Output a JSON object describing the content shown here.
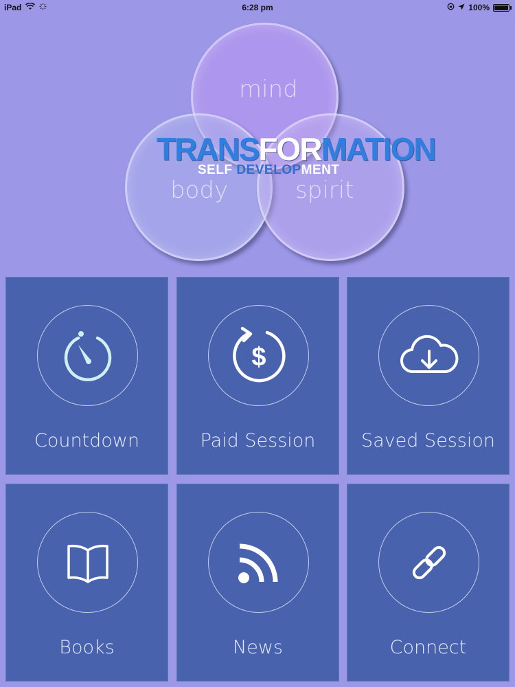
{
  "status_bar": {
    "device": "iPad",
    "time": "6:28 pm",
    "battery": "100%",
    "battery_level": 1.0,
    "icons": [
      "wifi-icon",
      "activity-icon",
      "rotation-lock-icon",
      "location-arrow-icon",
      "battery-icon"
    ]
  },
  "logo": {
    "title_a": "TRANS",
    "title_b": "FOR",
    "title_c": "MATION",
    "subtitle_a": "SELF ",
    "subtitle_b": "DEVELOP",
    "subtitle_c": "MENT",
    "circles": {
      "mind": "mind",
      "body": "body",
      "spirit": "spirit"
    }
  },
  "menu": {
    "items": [
      {
        "label": "Countdown",
        "icon": "stopwatch-icon"
      },
      {
        "label": "Paid Session",
        "icon": "dollar-refresh-icon"
      },
      {
        "label": "Saved Session",
        "icon": "cloud-download-icon"
      },
      {
        "label": "Books",
        "icon": "book-icon"
      },
      {
        "label": "News",
        "icon": "rss-icon"
      },
      {
        "label": "Connect",
        "icon": "link-icon"
      }
    ]
  },
  "colors": {
    "background": "#9d97e8",
    "tile": "#4862ad",
    "logo_blue": "#2f7fe0",
    "icon_countdown": "#cfeff5",
    "icon_default": "#ffffff"
  }
}
